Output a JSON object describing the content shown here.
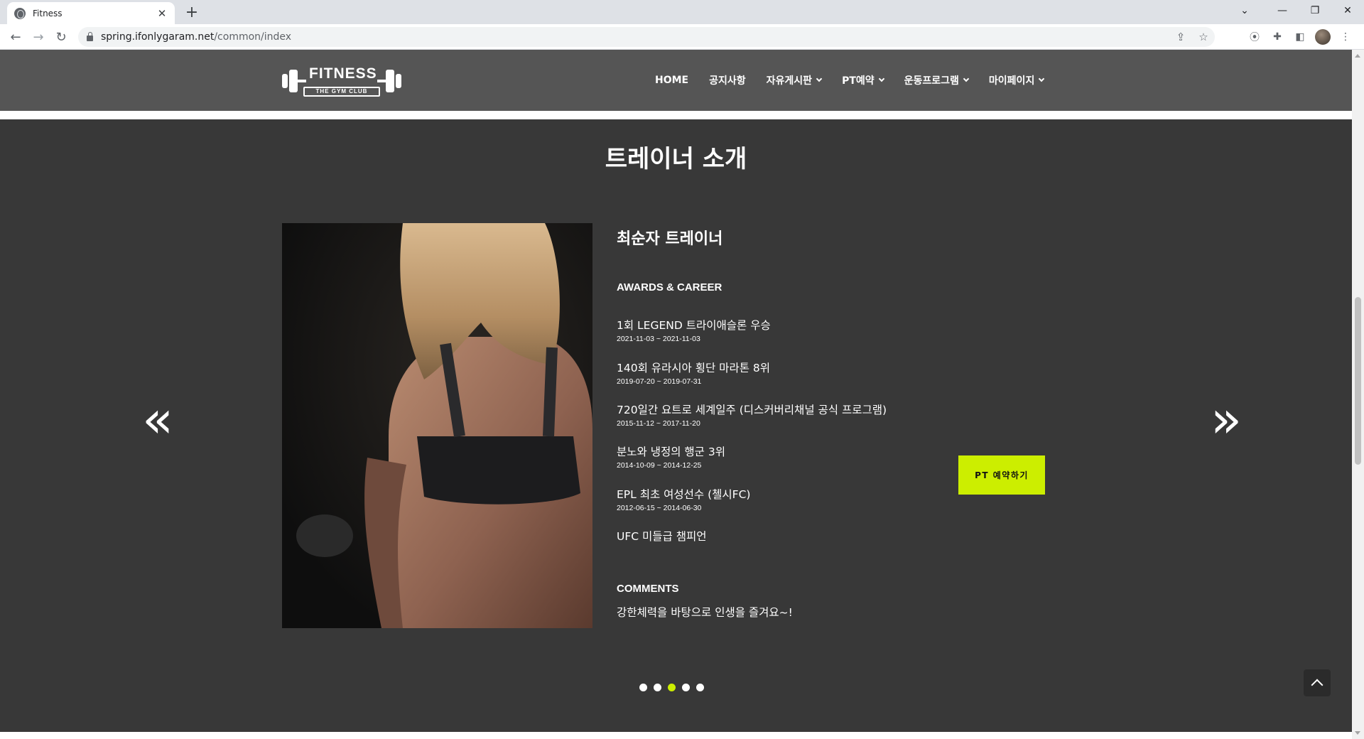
{
  "browser": {
    "tab_title": "Fitness",
    "tab_close": "✕",
    "new_tab": "+",
    "url_host": "spring.ifonlygaram.net",
    "url_path": "/common/index",
    "window_controls": {
      "tab_search": "⌄",
      "minimize": "—",
      "restore": "❐",
      "close": "✕"
    }
  },
  "logo": {
    "word": "FITNESS",
    "tagline": "THE GYM CLUB"
  },
  "nav": {
    "items": [
      {
        "label": "HOME",
        "dropdown": false
      },
      {
        "label": "공지사항",
        "dropdown": false
      },
      {
        "label": "자유게시판",
        "dropdown": true
      },
      {
        "label": "PT예약",
        "dropdown": true
      },
      {
        "label": "운동프로그램",
        "dropdown": true
      },
      {
        "label": "마이페이지",
        "dropdown": true
      }
    ]
  },
  "section": {
    "title": "트레이너 소개"
  },
  "trainer": {
    "name": "최순자 트레이너",
    "awards_heading": "AWARDS & CAREER",
    "awards": [
      {
        "title": "1회 LEGEND 트라이애슬론 우승",
        "date": "2021-11-03 ~ 2021-11-03"
      },
      {
        "title": "140회 유라시아 횡단 마라톤 8위",
        "date": "2019-07-20 ~ 2019-07-31"
      },
      {
        "title": "720일간 요트로 세계일주 (디스커버리채널 공식 프로그램)",
        "date": "2015-11-12 ~ 2017-11-20"
      },
      {
        "title": "분노와 냉정의 행군 3위",
        "date": "2014-10-09 ~ 2014-12-25"
      },
      {
        "title": "EPL 최초 여성선수 (첼시FC)",
        "date": "2012-06-15 ~ 2014-06-30"
      },
      {
        "title": "UFC 미들급 챔피언",
        "date": ""
      }
    ],
    "comments_heading": "COMMENTS",
    "comment": "강한체력을 바탕으로 인생을 즐겨요~!"
  },
  "cta": {
    "label": "PT 예약하기"
  },
  "carousel": {
    "prev": "«",
    "next": "»",
    "dots": 5,
    "active_index": 2
  },
  "colors": {
    "accent": "#ccee00",
    "header_bg": "#555555",
    "section_bg": "#383838"
  }
}
